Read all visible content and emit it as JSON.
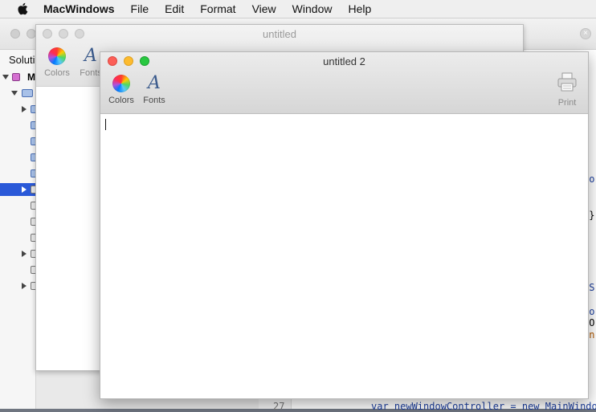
{
  "menubar": {
    "app": "MacWindows",
    "items": [
      "File",
      "Edit",
      "Format",
      "View",
      "Window",
      "Help"
    ]
  },
  "ide": {
    "sidebar_label": "Solutio",
    "tree_top_label": "M",
    "code_lines": [
      {
        "text": "io",
        "class": "code-kw"
      },
      {
        "text": ";",
        "class": ""
      },
      {
        "text": ";}",
        "class": ""
      },
      {
        "text": "NS",
        "class": "code-kw"
      },
      {
        "text": "Co",
        "class": "code-kw"
      },
      {
        "text": "dO",
        "class": ""
      },
      {
        "text": "un",
        "class": "code-orange"
      }
    ],
    "bottom_line_number": "27",
    "bottom_code": "var newWindowController = new MainWindo"
  },
  "window_back": {
    "title": "untitled",
    "toolbar": {
      "colors_label": "Colors",
      "fonts_label": "Fonts"
    }
  },
  "window_front": {
    "title": "untitled 2",
    "toolbar": {
      "colors_label": "Colors",
      "fonts_label": "Fonts",
      "print_label": "Print"
    }
  },
  "icons": {
    "apple": "apple-icon",
    "colors": "color-wheel-icon",
    "fonts": "font-icon",
    "print": "printer-icon"
  }
}
